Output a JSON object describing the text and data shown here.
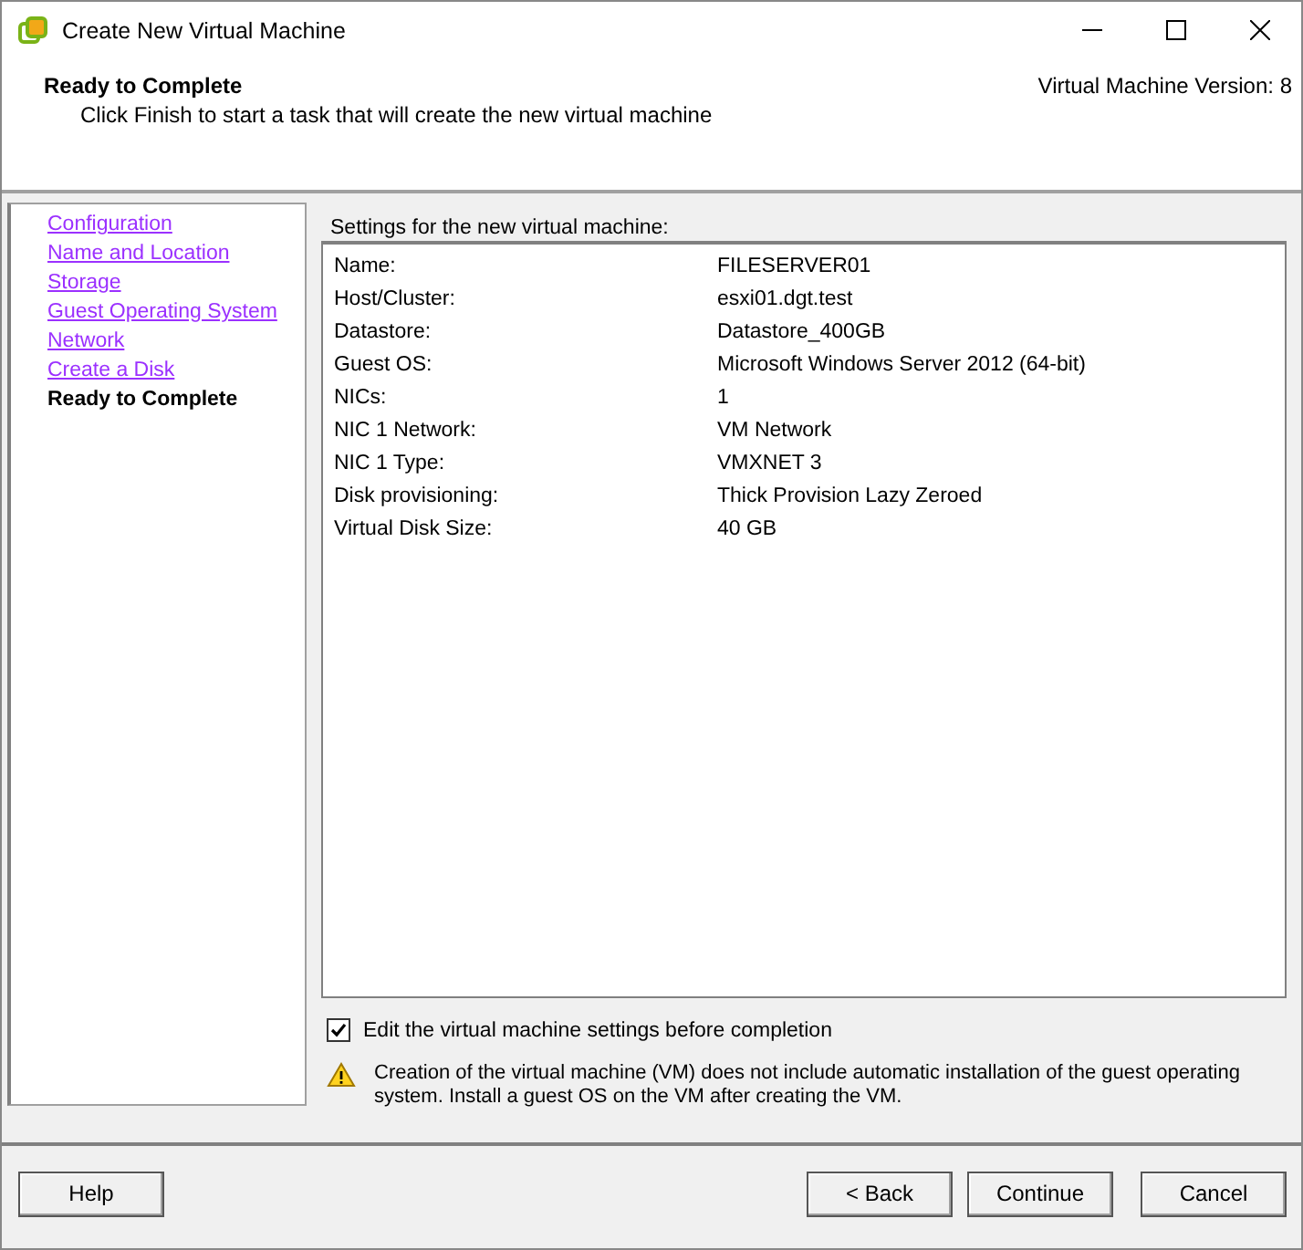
{
  "window": {
    "title": "Create New Virtual Machine"
  },
  "header": {
    "title": "Ready to Complete",
    "subtitle": "Click Finish to start a task that will create the new virtual machine",
    "version": "Virtual Machine Version: 8"
  },
  "steps": [
    {
      "label": "Configuration",
      "selected": false
    },
    {
      "label": "Name and Location",
      "selected": false
    },
    {
      "label": "Storage",
      "selected": false
    },
    {
      "label": "Guest Operating System",
      "selected": false
    },
    {
      "label": "Network",
      "selected": false
    },
    {
      "label": "Create a Disk",
      "selected": false
    },
    {
      "label": "Ready to Complete",
      "selected": true
    }
  ],
  "settings": {
    "title": "Settings for the new virtual machine:",
    "rows": [
      {
        "label": "Name:",
        "value": "FILESERVER01"
      },
      {
        "label": "Host/Cluster:",
        "value": "esxi01.dgt.test"
      },
      {
        "label": "Datastore:",
        "value": "Datastore_400GB"
      },
      {
        "label": "Guest OS:",
        "value": "Microsoft Windows Server 2012 (64-bit)"
      },
      {
        "label": "NICs:",
        "value": "1"
      },
      {
        "label": "NIC 1 Network:",
        "value": "VM Network"
      },
      {
        "label": "NIC 1 Type:",
        "value": "VMXNET 3"
      },
      {
        "label": "Disk provisioning:",
        "value": "Thick Provision Lazy Zeroed"
      },
      {
        "label": "Virtual Disk Size:",
        "value": "40 GB"
      }
    ]
  },
  "edit_option": {
    "label": "Edit the virtual machine settings before completion",
    "checked": true
  },
  "warning": "Creation of the virtual machine (VM) does not include automatic installation of the guest operating system. Install a guest OS on the VM after creating the VM.",
  "buttons": {
    "help": "Help",
    "back": "< Back",
    "continue": "Continue",
    "cancel": "Cancel"
  }
}
